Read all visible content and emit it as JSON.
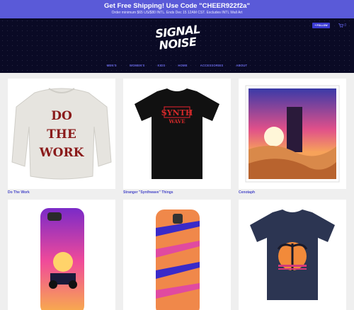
{
  "promo": {
    "title": "Get Free Shipping! Use Code \"CHEER922f2a\"",
    "subtitle": "Order minimum $65 US/$80 INTL. Ends Dec 15 12AM CST. Excludes INTL Wall Art"
  },
  "header": {
    "logo_line1": "SIGNAL",
    "logo_line2": "NOISE",
    "follow_label": "+ FOLLOW",
    "cart_count": "0"
  },
  "nav": [
    "MEN'S",
    "WOMEN'S",
    "KIDS",
    "HOME",
    "ACCESSORIES",
    "ABOUT"
  ],
  "products": [
    {
      "name": "Do The Work",
      "art_text": [
        "DO",
        "THE",
        "WORK"
      ]
    },
    {
      "name": "Stranger \"Synthwave\" Things",
      "art_text": [
        "SYNTH",
        "WAVE"
      ]
    },
    {
      "name": "Cenotaph"
    },
    {
      "name": ""
    },
    {
      "name": ""
    },
    {
      "name": ""
    }
  ],
  "colors": {
    "accent": "#5a5ad8",
    "header_bg": "#0a0a25",
    "link": "#4848c8"
  }
}
